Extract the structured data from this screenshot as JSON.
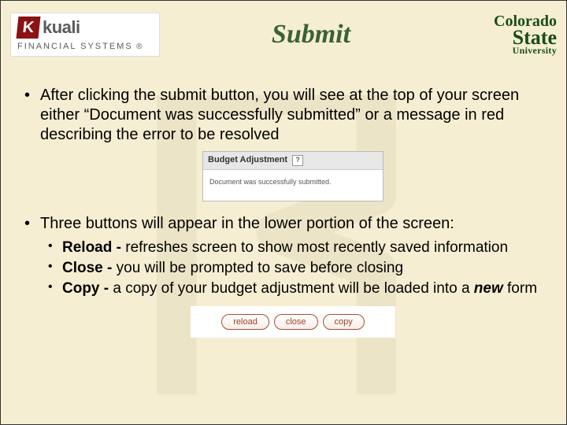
{
  "header": {
    "kuali_logo": {
      "brand": "kuali",
      "sub": "FINANCIAL SYSTEMS",
      "registered": "®",
      "k": "K"
    },
    "title": "Submit",
    "csu_logo": {
      "l1": "Colorado",
      "l2": "State",
      "l3": "University"
    }
  },
  "bullets": {
    "b1": "After clicking the submit button, you will see at the top of your screen either “Document was successfully submitted” or a message in red describing the error to be resolved",
    "b2": "Three buttons will appear in the lower portion of the screen:",
    "sub": {
      "reload_label": "Reload",
      "reload_sep": " - ",
      "reload_desc": "refreshes screen to show most recently saved information",
      "close_label": "Close",
      "close_sep": " - ",
      "close_desc": "you will be prompted to save before closing",
      "copy_label": "Copy",
      "copy_sep": " - ",
      "copy_desc_a": "a copy of your budget adjustment will be loaded into a ",
      "copy_desc_new": "new",
      "copy_desc_b": " form"
    }
  },
  "screenshot": {
    "bar_title": "Budget Adjustment",
    "help": "?",
    "message": "Document was successfully submitted."
  },
  "buttons": {
    "reload": "reload",
    "close": "close",
    "copy": "copy"
  }
}
